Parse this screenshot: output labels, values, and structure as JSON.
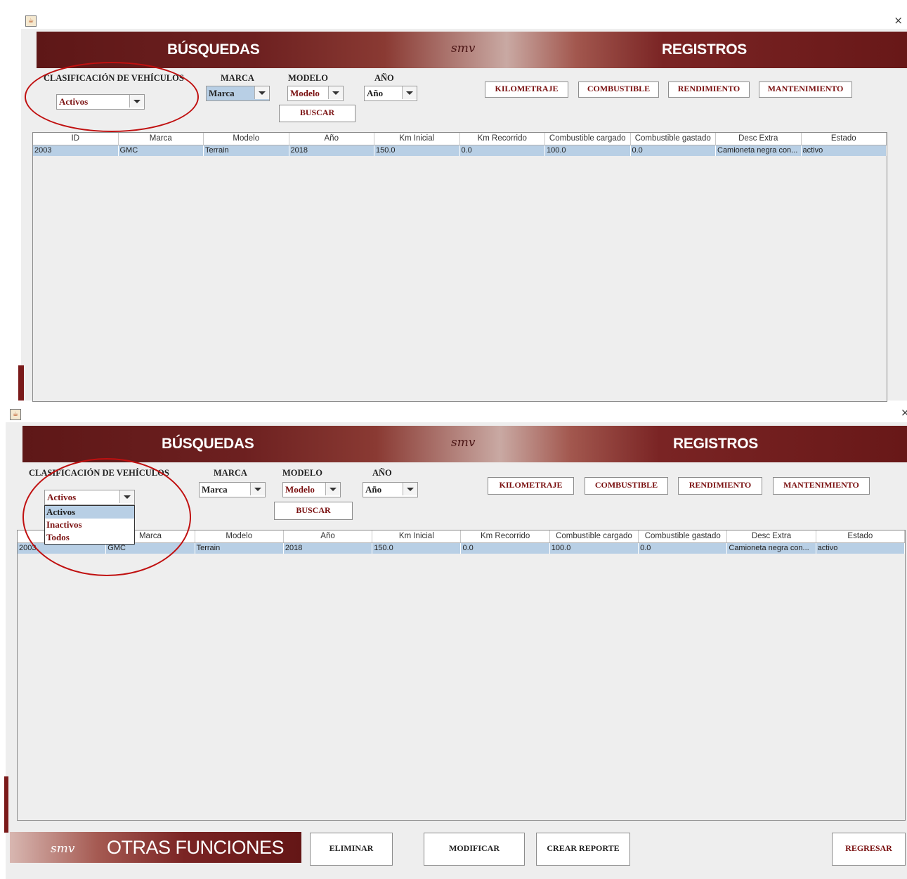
{
  "colors": {
    "accent_dark": "#6d2020",
    "selection": "#b8cfe5",
    "annotation": "#c01010"
  },
  "icons": {
    "window_icon": "java-icon",
    "close": "close-icon",
    "dropdown_arrow": "chevron-down-icon"
  },
  "window_top": {
    "close": "×",
    "banner": {
      "left_title": "BÚSQUEDAS",
      "logo": "smv",
      "right_title": "REGISTROS"
    },
    "filters": {
      "classification_label": "CLASIFICACIÓN DE VEHÍCULOS",
      "classification_value": "Activos",
      "marca_label": "MARCA",
      "marca_value": "Marca",
      "modelo_label": "MODELO",
      "modelo_value": "Modelo",
      "anio_label": "AÑO",
      "anio_value": "Año",
      "buscar": "BUSCAR"
    },
    "registros_buttons": [
      "KILOMETRAJE",
      "COMBUSTIBLE",
      "RENDIMIENTO",
      "MANTENIMIENTO"
    ]
  },
  "window_bottom": {
    "close": "×",
    "banner": {
      "left_title": "BÚSQUEDAS",
      "logo": "smv",
      "right_title": "REGISTROS"
    },
    "filters": {
      "classification_label": "CLASIFICACIÓN DE VEHÍCULOS",
      "classification_value": "Activos",
      "options": [
        "Activos",
        "Inactivos",
        "Todos"
      ],
      "marca_label": "MARCA",
      "marca_value": "Marca",
      "modelo_label": "MODELO",
      "modelo_value": "Modelo",
      "anio_label": "AÑO",
      "anio_value": "Año",
      "buscar": "BUSCAR"
    },
    "registros_buttons": [
      "KILOMETRAJE",
      "COMBUSTIBLE",
      "RENDIMIENTO",
      "MANTENIMIENTO"
    ],
    "footer": {
      "logo": "smv",
      "title": "OTRAS FUNCIONES",
      "eliminar": "ELIMINAR",
      "modificar": "MODIFICAR",
      "crear_reporte": "CREAR REPORTE",
      "regresar": "REGRESAR"
    }
  },
  "table": {
    "columns": [
      "ID",
      "Marca",
      "Modelo",
      "Año",
      "Km Inicial",
      "Km Recorrido",
      "Combustible cargado",
      "Combustible gastado",
      "Desc Extra",
      "Estado"
    ],
    "rows": [
      [
        "2003",
        "GMC",
        "Terrain",
        "2018",
        "150.0",
        "0.0",
        "100.0",
        "0.0",
        "Camioneta negra con...",
        "activo"
      ]
    ]
  }
}
